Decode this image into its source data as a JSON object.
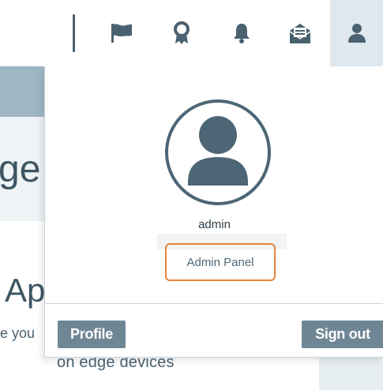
{
  "header": {
    "icons": [
      "flag-icon",
      "award-icon",
      "bell-icon",
      "mail-icon",
      "user-icon"
    ]
  },
  "background": {
    "heading_fragment": "ge",
    "title_fragment": "Ap",
    "text_fragment": "e you",
    "text_line": "on edge devices"
  },
  "user_menu": {
    "avatar": "user-avatar-icon",
    "username": "admin",
    "admin_link": "Admin Panel",
    "profile_button": "Profile",
    "signout_button": "Sign out"
  },
  "colors": {
    "primary": "#4c6675",
    "button": "#6f8795",
    "highlight": "#e8843a",
    "active_tab": "#dfe8ee"
  }
}
